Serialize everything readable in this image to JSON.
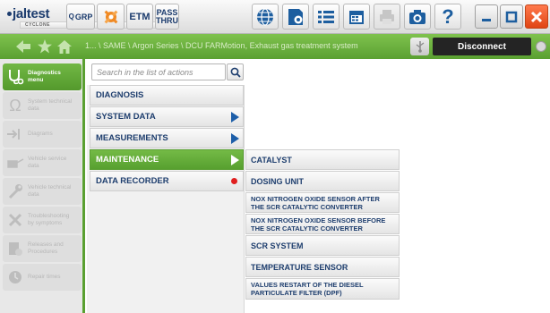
{
  "app": {
    "logo": "jaltest",
    "logo_sub": "CYCLONE"
  },
  "toolbar": {
    "grp_label": "GRP",
    "etm_label": "ETM",
    "pass_line1": "PASS",
    "pass_line2": "THRU",
    "help_label": "?",
    "icons": [
      "globe-icon",
      "settings-icon",
      "list-icon",
      "calendar-icon",
      "print-icon",
      "camera-icon",
      "help-icon",
      "minimize-icon",
      "maximize-icon",
      "close-icon"
    ]
  },
  "nav": {
    "breadcrumb": "1... \\ SAME \\ Argon Series \\ DCU FARMotion, Exhaust gas treatment system",
    "disconnect_label": "Disconnect"
  },
  "sidebar": {
    "items": [
      {
        "label1": "Diagnostics",
        "label2": "menu",
        "icon": "stethoscope-icon",
        "active": true
      },
      {
        "label1": "System technical",
        "label2": "data",
        "icon": "ohm-icon",
        "active": false
      },
      {
        "label1": "Diagrams",
        "label2": "",
        "icon": "diagram-icon",
        "active": false
      },
      {
        "label1": "Vehicle service",
        "label2": "data",
        "icon": "oil-can-icon",
        "active": false
      },
      {
        "label1": "Vehicle technical",
        "label2": "data",
        "icon": "wrench-icon",
        "active": false
      },
      {
        "label1": "Troubleshooting",
        "label2": "by symptoms",
        "icon": "tools-icon",
        "active": false
      },
      {
        "label1": "Releases and",
        "label2": "Procedures",
        "icon": "procedures-icon",
        "active": false
      },
      {
        "label1": "Repair times",
        "label2": "",
        "icon": "repair-times-icon",
        "active": false
      }
    ]
  },
  "search": {
    "placeholder": "Search in the list of actions"
  },
  "actions": [
    {
      "label": "DIAGNOSIS",
      "arrow": false,
      "dot": false,
      "selected": false
    },
    {
      "label": "SYSTEM DATA",
      "arrow": true,
      "dot": false,
      "selected": false
    },
    {
      "label": "MEASUREMENTS",
      "arrow": true,
      "dot": false,
      "selected": false
    },
    {
      "label": "MAINTENANCE",
      "arrow": true,
      "dot": false,
      "selected": true
    },
    {
      "label": "DATA RECORDER",
      "arrow": false,
      "dot": true,
      "selected": false
    }
  ],
  "sub_actions": [
    {
      "line1": "CATALYST",
      "line2": ""
    },
    {
      "line1": "DOSING UNIT",
      "line2": ""
    },
    {
      "line1": "NOX NITROGEN OXIDE SENSOR AFTER",
      "line2": "THE SCR CATALYTIC CONVERTER"
    },
    {
      "line1": "NOX NITROGEN OXIDE SENSOR BEFORE",
      "line2": "THE SCR CATALYTIC CONVERTER"
    },
    {
      "line1": "SCR SYSTEM",
      "line2": ""
    },
    {
      "line1": "TEMPERATURE SENSOR",
      "line2": ""
    },
    {
      "line1": "VALUES RESTART OF THE DIESEL",
      "line2": "PARTICULATE FILTER (DPF)"
    }
  ],
  "colors": {
    "accent_green": "#5aa031",
    "nav_text": "#1e3e6e",
    "close_red": "#e04514",
    "record_red": "#e01f1f"
  }
}
